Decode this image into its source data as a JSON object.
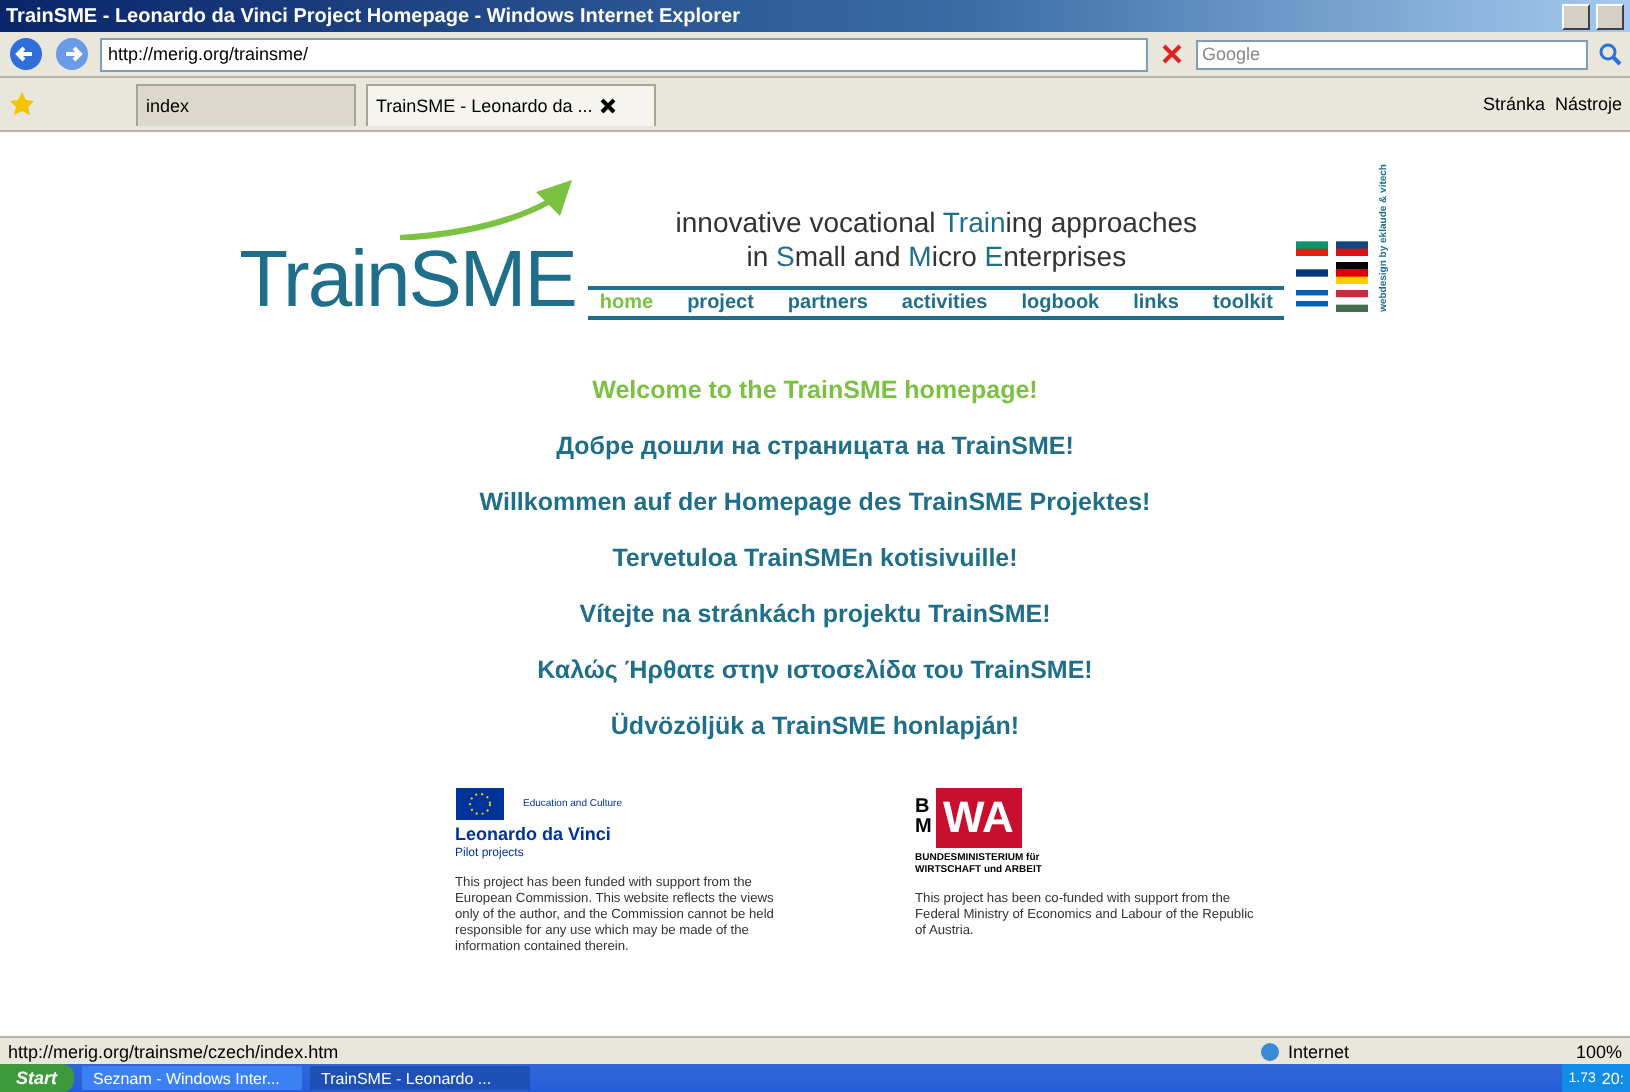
{
  "window": {
    "title": "TrainSME - Leonardo da Vinci Project Homepage - Windows Internet Explorer"
  },
  "address_bar": {
    "url": "http://merig.org/trainsme/",
    "search_placeholder": "Google"
  },
  "tabs": [
    {
      "label": "index",
      "selected": false
    },
    {
      "label": "TrainSME - Leonardo da ...",
      "selected": true
    }
  ],
  "command_bar": [
    "Stránka",
    "Nástroje"
  ],
  "site_header": {
    "logo": "TrainSME",
    "tagline": [
      "innovative vocational **Train**ing approaches",
      "in **S**mall and **M**icro **E**nterprises"
    ],
    "credit": "webdesign by eklaude & vitech",
    "nav": [
      {
        "label": "home",
        "selected": true
      },
      {
        "label": "project",
        "selected": false
      },
      {
        "label": "partners",
        "selected": false
      },
      {
        "label": "activities",
        "selected": false
      },
      {
        "label": "logbook",
        "selected": false
      },
      {
        "label": "links",
        "selected": false
      },
      {
        "label": "toolkit",
        "selected": false
      }
    ]
  },
  "welcome": [
    {
      "text": "Welcome to the TrainSME homepage!",
      "color": "#7cc242"
    },
    {
      "text": "Добре дошли на страницата на TrainSME!",
      "color": "#1f6f8b"
    },
    {
      "text": "Willkommen auf der Homepage des TrainSME Projektes!",
      "color": "#1f6f8b"
    },
    {
      "text": "Tervetuloa TrainSMEn kotisivuille!",
      "color": "#1f6f8b"
    },
    {
      "text": "Vítejte na stránkách projektu TrainSME!",
      "color": "#1f6f8b"
    },
    {
      "text": "Καλώς Ήρθατε στην ιστοσελίδα του TrainSME!",
      "color": "#1f6f8b"
    },
    {
      "text": "Üdvözöljük a TrainSME honlapján!",
      "color": "#1f6f8b"
    }
  ],
  "funding": [
    {
      "kind": "eu",
      "logo_caption": "Education and Culture",
      "logo_title": "Leonardo da Vinci",
      "logo_subtitle": "Pilot projects",
      "note": "This project has been funded with support from the European Commission. This website reflects the views only of the author, and the Commission cannot be held responsible for any use which may be made of the information contained therein."
    },
    {
      "kind": "bmwa",
      "logo_left": "BM",
      "logo_right": "WA",
      "logo_subtitle": "BUNDESMINISTERIUM für WIRTSCHAFT und ARBEIT",
      "note": "This project has been co-funded with support from the Federal Ministry of Economics and Labour of the Republic of Austria."
    }
  ],
  "status_bar": {
    "text": "http://merig.org/trainsme/czech/index.htm",
    "zone": "Internet",
    "zoom": "100%"
  },
  "taskbar": {
    "start": "Start",
    "tasks": [
      {
        "label": "Seznam - Windows Inter...",
        "selected": false
      },
      {
        "label": "TrainSME - Leonardo ...",
        "selected": true
      }
    ],
    "tray": "1.73",
    "clock": "20:"
  }
}
